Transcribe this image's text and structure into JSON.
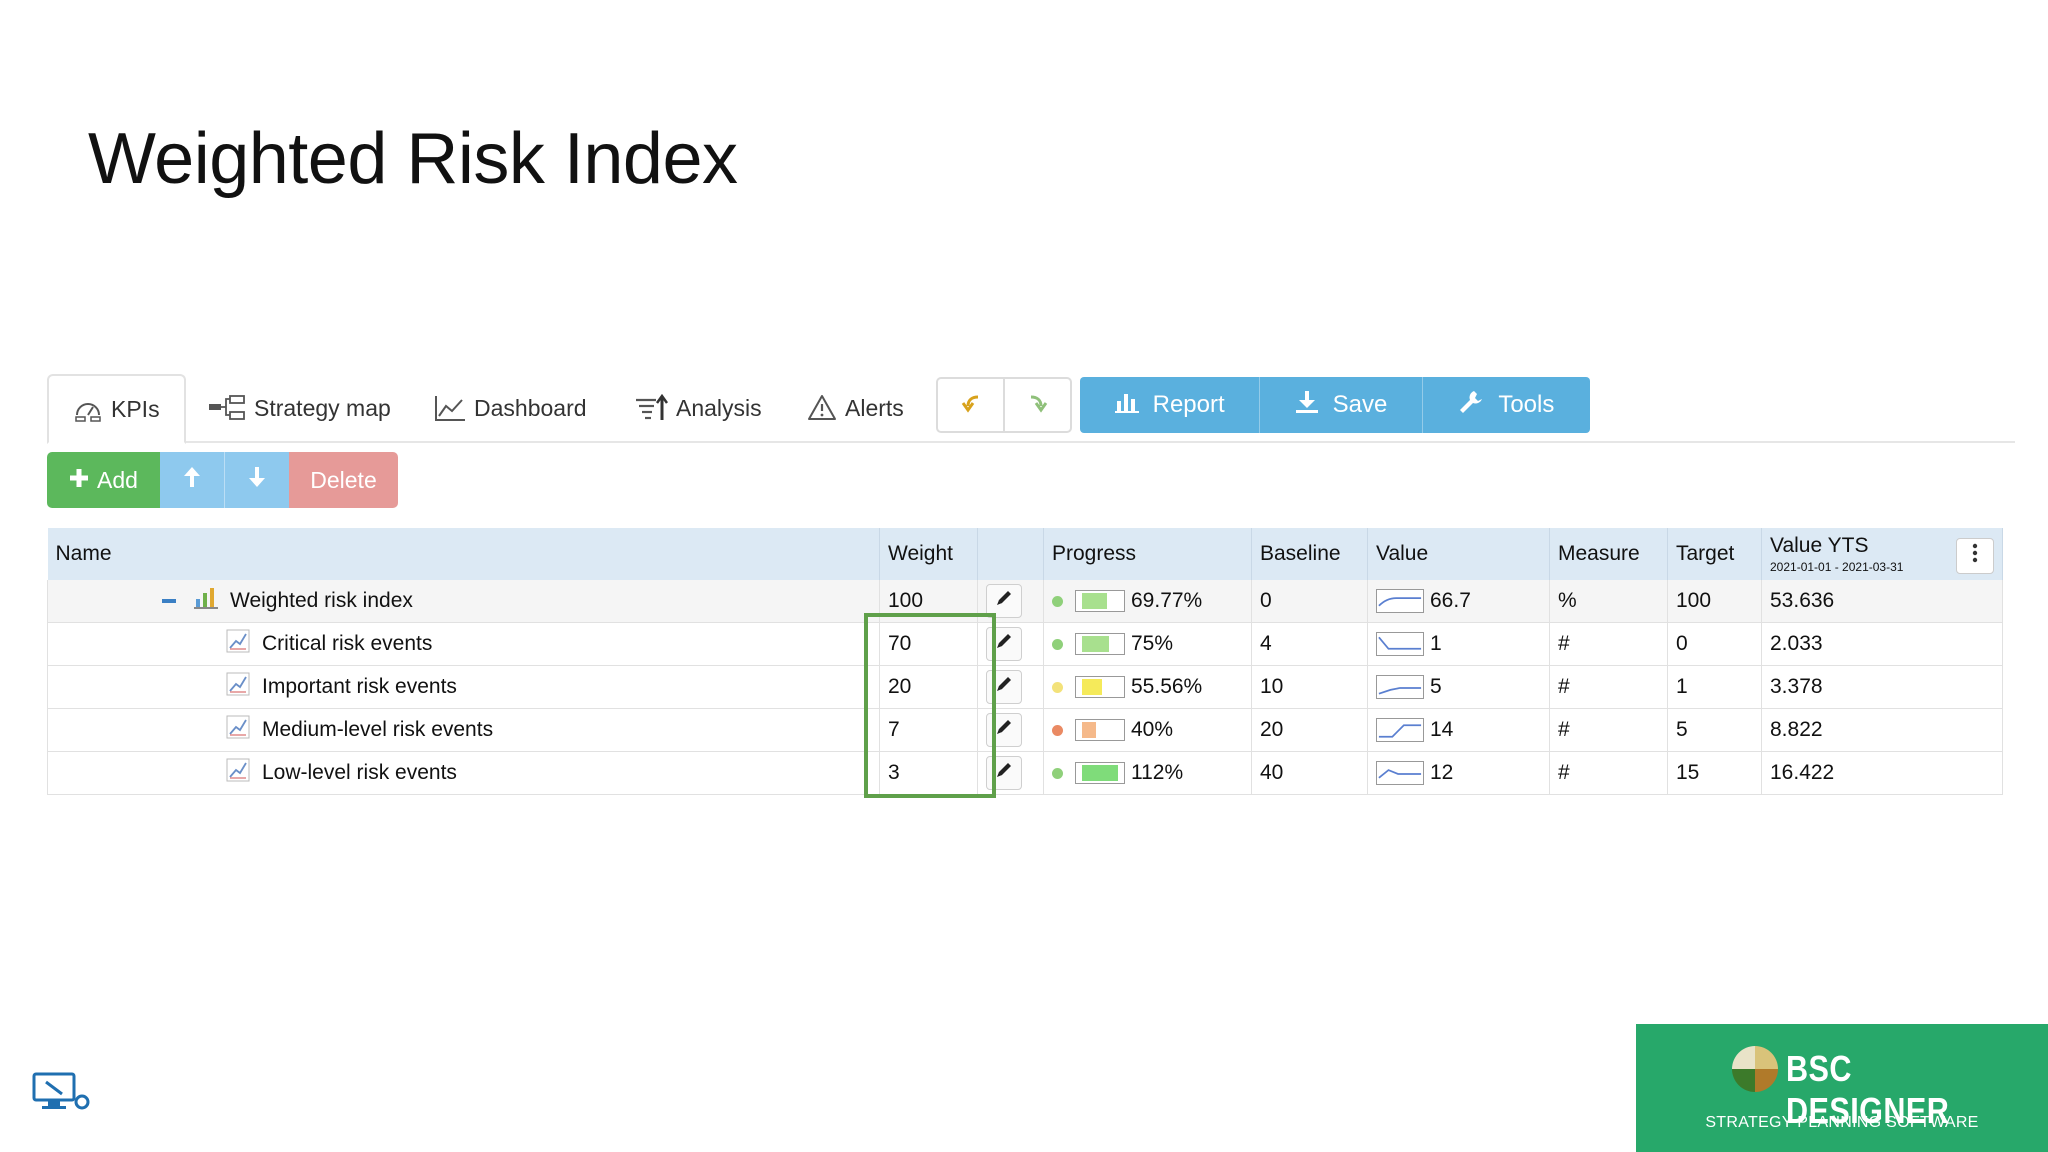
{
  "page": {
    "title": "Weighted Risk Index"
  },
  "tabs": [
    {
      "label": "KPIs",
      "active": true
    },
    {
      "label": "Strategy map"
    },
    {
      "label": "Dashboard"
    },
    {
      "label": "Analysis"
    },
    {
      "label": "Alerts"
    }
  ],
  "toolbar": {
    "report": "Report",
    "save": "Save",
    "tools": "Tools"
  },
  "actions": {
    "add": "Add",
    "delete": "Delete"
  },
  "table": {
    "columns": {
      "name": "Name",
      "weight": "Weight",
      "progress": "Progress",
      "baseline": "Baseline",
      "value": "Value",
      "measure": "Measure",
      "target": "Target",
      "value_yts": "Value YTS",
      "value_yts_range": "2021-01-01 - 2021-03-31"
    },
    "rows": [
      {
        "name": "Weighted risk index",
        "weight": "100",
        "progress": "69.77%",
        "progress_fraction": 0.6977,
        "status_color": "#8fd07a",
        "bar_color": "#a8e08e",
        "baseline": "0",
        "value": "66.7",
        "measure": "%",
        "target": "100",
        "value_yts": "53.636"
      },
      {
        "name": "Critical risk events",
        "weight": "70",
        "progress": "75%",
        "progress_fraction": 0.75,
        "status_color": "#8fd07a",
        "bar_color": "#a8e08e",
        "baseline": "4",
        "value": "1",
        "measure": "#",
        "target": "0",
        "value_yts": "2.033"
      },
      {
        "name": "Important risk events",
        "weight": "20",
        "progress": "55.56%",
        "progress_fraction": 0.5556,
        "status_color": "#f3e27a",
        "bar_color": "#f5ea5a",
        "baseline": "10",
        "value": "5",
        "measure": "#",
        "target": "1",
        "value_yts": "3.378"
      },
      {
        "name": "Medium-level risk events",
        "weight": "7",
        "progress": "40%",
        "progress_fraction": 0.4,
        "status_color": "#ea8a63",
        "bar_color": "#f5b98a",
        "baseline": "20",
        "value": "14",
        "measure": "#",
        "target": "5",
        "value_yts": "8.822"
      },
      {
        "name": "Low-level risk events",
        "weight": "3",
        "progress": "112%",
        "progress_fraction": 1.0,
        "status_color": "#8fd07a",
        "bar_color": "#7fdc7a",
        "baseline": "40",
        "value": "12",
        "measure": "#",
        "target": "15",
        "value_yts": "16.422"
      }
    ]
  },
  "brand": {
    "name": "BSC DESIGNER",
    "tagline": "STRATEGY PLANNING SOFTWARE",
    "color": "#27a86a"
  },
  "colors": {
    "highlight": "#5fa04a",
    "header_bg": "#dce9f4",
    "toolbar_blue": "#5ab0de"
  }
}
